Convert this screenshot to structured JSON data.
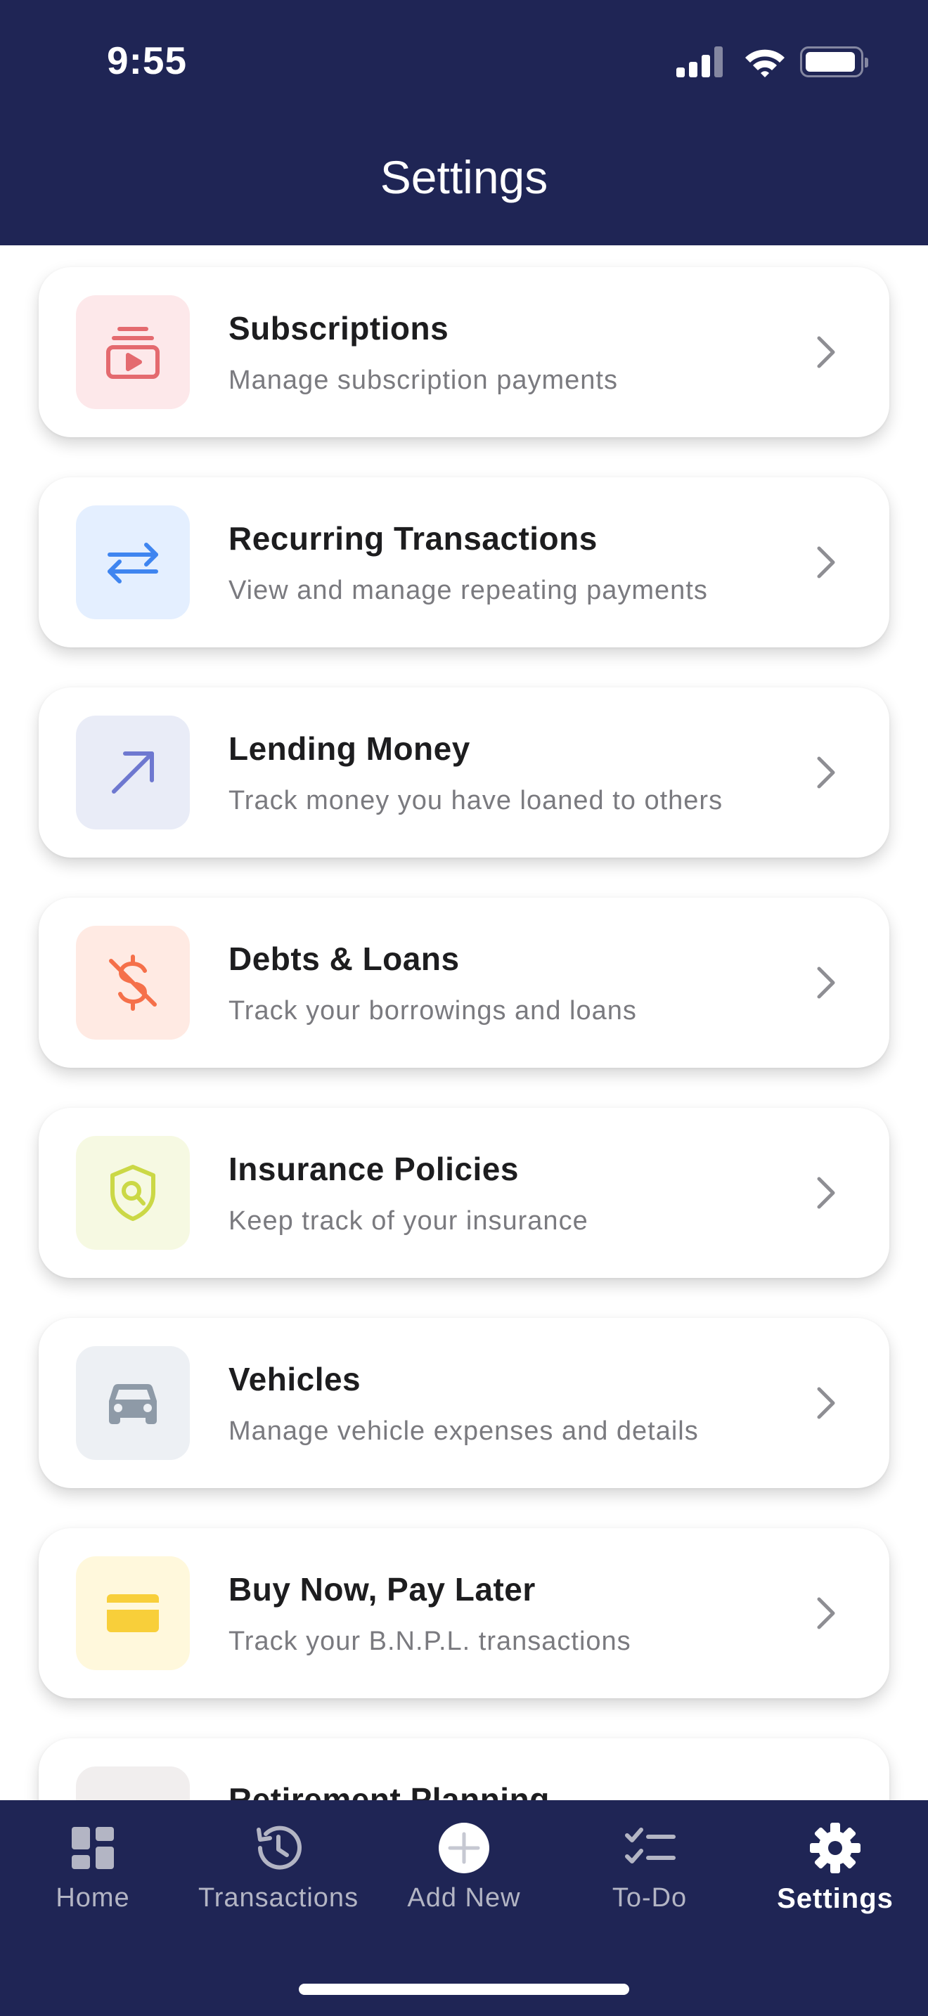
{
  "status_bar": {
    "time": "9:55"
  },
  "header": {
    "title": "Settings"
  },
  "items": [
    {
      "title": "Subscriptions",
      "subtitle": "Manage subscription payments",
      "icon": "subscription-icon",
      "tint": "#fde8ea",
      "color": "#e46a6f"
    },
    {
      "title": "Recurring Transactions",
      "subtitle": "View and manage repeating payments",
      "icon": "repeat-arrows-icon",
      "tint": "#e4efff",
      "color": "#3f85f0"
    },
    {
      "title": "Lending Money",
      "subtitle": "Track money you have loaned to others",
      "icon": "arrow-up-right-icon",
      "tint": "#e9ecf7",
      "color": "#6e78d0"
    },
    {
      "title": "Debts & Loans",
      "subtitle": "Track your borrowings and loans",
      "icon": "dollar-off-icon",
      "tint": "#ffeae3",
      "color": "#f5704a"
    },
    {
      "title": "Insurance Policies",
      "subtitle": "Keep track of your insurance",
      "icon": "shield-search-icon",
      "tint": "#f6f9e2",
      "color": "#cbd846"
    },
    {
      "title": "Vehicles",
      "subtitle": "Manage vehicle expenses and details",
      "icon": "car-icon",
      "tint": "#edf0f4",
      "color": "#8e9aa7"
    },
    {
      "title": "Buy Now, Pay Later",
      "subtitle": "Track your B.N.P.L. transactions",
      "icon": "credit-card-icon",
      "tint": "#fff8dc",
      "color": "#f8cf3a"
    },
    {
      "title": "Retirement Planning",
      "subtitle": "",
      "icon": "person-icon",
      "tint": "#f1eeee",
      "color": "#8c8888"
    }
  ],
  "tabbar": {
    "tabs": [
      {
        "label": "Home",
        "icon": "dashboard-icon"
      },
      {
        "label": "Transactions",
        "icon": "history-icon"
      },
      {
        "label": "Add New",
        "icon": "plus-circle-icon"
      },
      {
        "label": "To-Do",
        "icon": "checklist-icon"
      },
      {
        "label": "Settings",
        "icon": "gear-icon",
        "active": true
      }
    ]
  }
}
